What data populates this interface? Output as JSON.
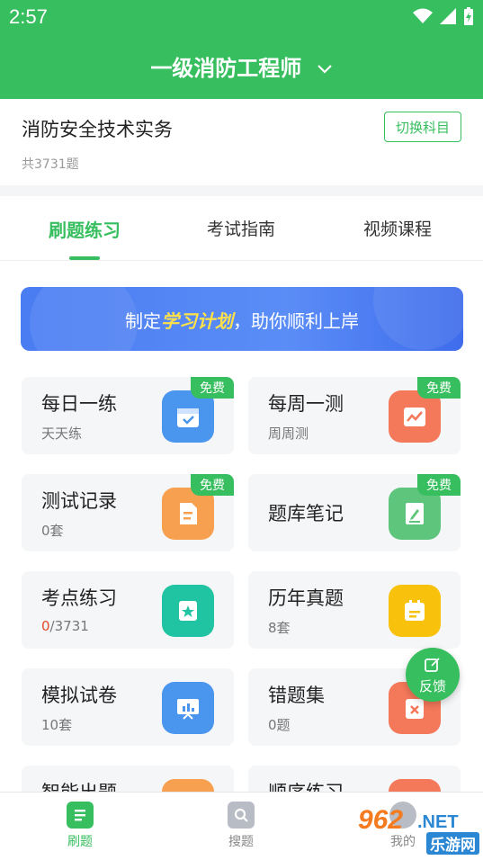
{
  "status_bar": {
    "time": "2:57"
  },
  "header": {
    "title": "一级消防工程师"
  },
  "subject": {
    "name": "消防安全技术实务",
    "count": "共3731题",
    "switch_label": "切换科目"
  },
  "tabs": [
    {
      "label": "刷题练习",
      "active": true
    },
    {
      "label": "考试指南",
      "active": false
    },
    {
      "label": "视频课程",
      "active": false
    }
  ],
  "banner": {
    "prefix": "制定",
    "highlight": "学习计划",
    "suffix": "，助你顺利上岸"
  },
  "badge_label": "免费",
  "cards": [
    {
      "title": "每日一练",
      "sub": "天天练",
      "icon": "calendar-check-icon",
      "color": "#4A95EE",
      "free": true
    },
    {
      "title": "每周一测",
      "sub": "周周测",
      "icon": "chart-icon",
      "color": "#F4785A",
      "free": true
    },
    {
      "title": "测试记录",
      "sub": "0套",
      "icon": "document-icon",
      "color": "#F7A050",
      "free": true
    },
    {
      "title": "题库笔记",
      "sub": "",
      "icon": "note-pen-icon",
      "color": "#5DC57C",
      "free": true
    },
    {
      "title": "考点练习",
      "sub_done": "0",
      "sub_total": "/3731",
      "icon": "star-book-icon",
      "color": "#21C4A2",
      "free": false
    },
    {
      "title": "历年真题",
      "sub": "8套",
      "icon": "calendar-icon",
      "color": "#F8C20C",
      "free": false
    },
    {
      "title": "模拟试卷",
      "sub": "10套",
      "icon": "presentation-icon",
      "color": "#4A95EE",
      "free": false
    },
    {
      "title": "错题集",
      "sub": "0题",
      "icon": "wrong-doc-icon",
      "color": "#F4785A",
      "free": false
    },
    {
      "title": "智能出题",
      "sub": "",
      "icon": "smart-icon",
      "color": "#F7A050",
      "free": false
    },
    {
      "title": "顺序练习",
      "sub": "",
      "icon": "order-icon",
      "color": "#F4785A",
      "free": false
    }
  ],
  "feedback": {
    "label": "反馈"
  },
  "bottom_nav": [
    {
      "label": "刷题",
      "active": true
    },
    {
      "label": "搜题",
      "active": false
    },
    {
      "label": "我的",
      "active": false
    }
  ],
  "watermark": {
    "number": "962",
    "domain": ".NET",
    "name": "乐游网"
  },
  "colors": {
    "primary": "#37BE5E",
    "banner": "#4A7CF2",
    "highlight": "#FFE24A"
  }
}
